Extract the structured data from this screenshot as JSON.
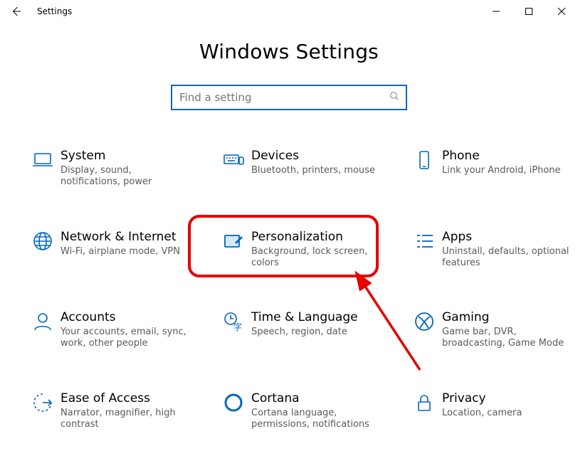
{
  "window": {
    "title": "Settings"
  },
  "page": {
    "heading": "Windows Settings"
  },
  "search": {
    "placeholder": "Find a setting",
    "value": ""
  },
  "categories": [
    {
      "id": "system",
      "title": "System",
      "subtitle": "Display, sound, notifications, power",
      "icon": "laptop-icon"
    },
    {
      "id": "devices",
      "title": "Devices",
      "subtitle": "Bluetooth, printers, mouse",
      "icon": "keyboard-icon"
    },
    {
      "id": "phone",
      "title": "Phone",
      "subtitle": "Link your Android, iPhone",
      "icon": "phone-icon"
    },
    {
      "id": "network",
      "title": "Network & Internet",
      "subtitle": "Wi-Fi, airplane mode, VPN",
      "icon": "globe-icon"
    },
    {
      "id": "personalization",
      "title": "Personalization",
      "subtitle": "Background, lock screen, colors",
      "icon": "personalization-icon"
    },
    {
      "id": "apps",
      "title": "Apps",
      "subtitle": "Uninstall, defaults, optional features",
      "icon": "apps-icon"
    },
    {
      "id": "accounts",
      "title": "Accounts",
      "subtitle": "Your accounts, email, sync, work, other people",
      "icon": "person-icon"
    },
    {
      "id": "time",
      "title": "Time & Language",
      "subtitle": "Speech, region, date",
      "icon": "time-language-icon"
    },
    {
      "id": "gaming",
      "title": "Gaming",
      "subtitle": "Game bar, DVR, broadcasting, Game Mode",
      "icon": "xbox-icon"
    },
    {
      "id": "ease",
      "title": "Ease of Access",
      "subtitle": "Narrator, magnifier, high contrast",
      "icon": "ease-icon"
    },
    {
      "id": "cortana",
      "title": "Cortana",
      "subtitle": "Cortana language, permissions, notifications",
      "icon": "cortana-icon"
    },
    {
      "id": "privacy",
      "title": "Privacy",
      "subtitle": "Location, camera",
      "icon": "lock-icon"
    }
  ],
  "annotations": {
    "highlighted_category": "personalization"
  },
  "colors": {
    "accent": "#0067c0",
    "highlight": "#e60000",
    "subtitle": "#5a5a5a"
  }
}
